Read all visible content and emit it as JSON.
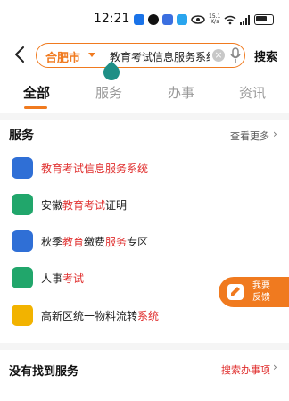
{
  "status_bar": {
    "time": "12:21",
    "net_speed_value": "15.1",
    "net_speed_unit": "K/s"
  },
  "search": {
    "city": "合肥市",
    "query": "教育考试信息服务系统",
    "button_label": "搜索"
  },
  "tabs": [
    {
      "label": "全部",
      "active": true
    },
    {
      "label": "服务",
      "active": false
    },
    {
      "label": "办事",
      "active": false
    },
    {
      "label": "资讯",
      "active": false
    }
  ],
  "services": {
    "title": "服务",
    "more_label": "查看更多",
    "items": [
      {
        "parts": [
          {
            "text": "教育考试信息服务系统",
            "hl": true
          }
        ],
        "icon": "id-card-icon",
        "color": "#2f6fd6"
      },
      {
        "parts": [
          {
            "text": "安徽",
            "hl": false
          },
          {
            "text": "教育考试",
            "hl": true
          },
          {
            "text": "证明",
            "hl": false
          }
        ],
        "icon": "layers-icon",
        "color": "#21a66b"
      },
      {
        "parts": [
          {
            "text": "秋季",
            "hl": false
          },
          {
            "text": "教育",
            "hl": true
          },
          {
            "text": "缴费",
            "hl": false
          },
          {
            "text": "服务",
            "hl": true
          },
          {
            "text": "专区",
            "hl": false
          }
        ],
        "icon": "book-icon",
        "color": "#2f6fd6"
      },
      {
        "parts": [
          {
            "text": "人事",
            "hl": false
          },
          {
            "text": "考试",
            "hl": true
          }
        ],
        "icon": "clipboard-icon",
        "color": "#21a66b"
      },
      {
        "parts": [
          {
            "text": "高新区统一物料流转",
            "hl": false
          },
          {
            "text": "系统",
            "hl": true
          }
        ],
        "icon": "folder-icon",
        "color": "#f2b300"
      }
    ]
  },
  "feedback": {
    "line1": "我要",
    "line2": "反馈"
  },
  "not_found": {
    "title": "没有找到服务",
    "link_label": "搜索办事项"
  },
  "colors": {
    "accent": "#f07a1f",
    "highlight": "#e0302f"
  }
}
